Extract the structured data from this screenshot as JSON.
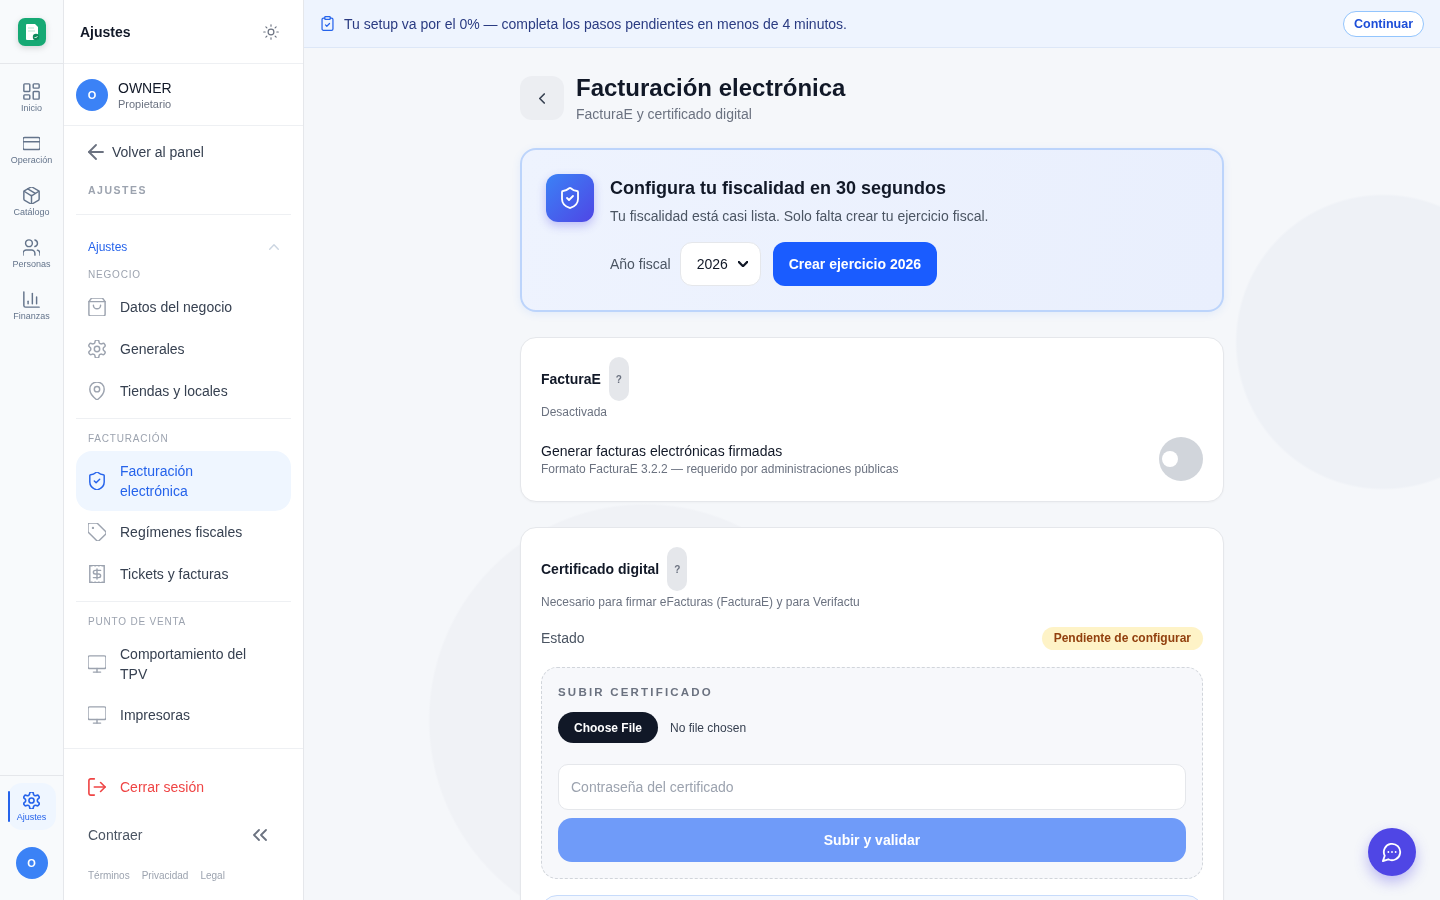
{
  "rail": {
    "items": [
      {
        "label": "Inicio",
        "selected": false
      },
      {
        "label": "Operación",
        "selected": false
      },
      {
        "label": "Catálogo",
        "selected": false
      },
      {
        "label": "Personas",
        "selected": false
      },
      {
        "label": "Finanzas",
        "selected": false
      }
    ],
    "bottom_items": [
      {
        "label": "Ajustes",
        "selected": true
      }
    ],
    "avatar_initial": "O"
  },
  "sidebar": {
    "title": "Ajustes",
    "user": {
      "initial": "O",
      "name": "OWNER",
      "role": "Propietario"
    },
    "back_link": "Volver al panel",
    "section_label": "AJUSTES",
    "group": {
      "label": "Ajustes",
      "expanded": true,
      "sections": [
        {
          "heading": "NEGOCIO",
          "items": [
            {
              "label": "Datos del negocio",
              "selected": false
            },
            {
              "label": "Generales",
              "selected": false
            },
            {
              "label": "Tiendas y locales",
              "selected": false
            }
          ]
        },
        {
          "heading": "FACTURACIÓN",
          "items": [
            {
              "label": "Facturación electrónica",
              "selected": true
            },
            {
              "label": "Regímenes fiscales",
              "selected": false
            },
            {
              "label": "Tickets y facturas",
              "selected": false
            }
          ]
        },
        {
          "heading": "PUNTO DE VENTA",
          "items": [
            {
              "label": "Comportamiento del TPV",
              "selected": false
            },
            {
              "label": "Impresoras",
              "selected": false
            }
          ]
        }
      ]
    },
    "logout": "Cerrar sesión",
    "collapse": "Contraer",
    "footer_links": [
      "Términos",
      "Privacidad",
      "Legal"
    ]
  },
  "banner": {
    "text": "Tu setup va por el 0% — completa los pasos pendientes en menos de 4 minutos.",
    "button": "Continuar"
  },
  "header": {
    "title": "Facturación electrónica",
    "subtitle": "FacturaE y certificado digital"
  },
  "setup_card": {
    "title": "Configura tu fiscalidad en 30 segundos",
    "description": "Tu fiscalidad está casi lista. Solo falta crear tu ejercicio fiscal.",
    "year_label": "Año fiscal",
    "year_value": "2026",
    "button": "Crear ejercicio 2026"
  },
  "facturae_card": {
    "title": "FacturaE",
    "help": "?",
    "status": "Desactivada",
    "setting": {
      "title": "Generar facturas electrónicas firmadas",
      "description": "Formato FacturaE 3.2.2 — requerido por administraciones públicas",
      "on": false
    }
  },
  "certificate_card": {
    "title": "Certificado digital",
    "help": "?",
    "description": "Necesario para firmar eFacturas (FacturaE) y para Verifactu",
    "status_label": "Estado",
    "status_badge": "Pendiente de configurar",
    "upload": {
      "heading": "SUBIR CERTIFICADO",
      "file_button": "Choose File",
      "file_status": "No file chosen",
      "password_placeholder": "Contraseña del certificado",
      "submit": "Subir y validar",
      "submit_disabled": true
    }
  }
}
